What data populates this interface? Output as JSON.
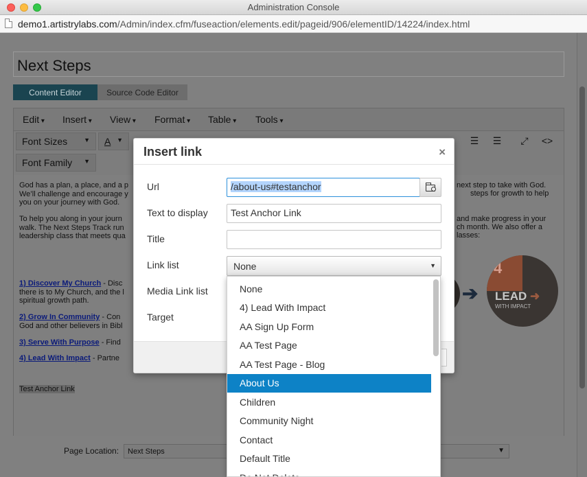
{
  "window": {
    "title": "Administration Console",
    "url_host": "demo1.artistrylabs.com",
    "url_path": "/Admin/index.cfm/fuseaction/elements.edit/pageid/906/elementID/14224/index.html"
  },
  "page": {
    "title_value": "Next Steps",
    "tabs": [
      "Content Editor",
      "Source Code Editor"
    ]
  },
  "editor": {
    "menu": [
      "Edit",
      "Insert",
      "View",
      "Format",
      "Table",
      "Tools"
    ],
    "font_sizes_label": "Font Sizes",
    "font_family_label": "Font Family",
    "text_color_glyph": "A"
  },
  "doc": {
    "p1_left": "God has a plan, a place, and a p",
    "p1_left_2": "We’ll challenge and encourage y",
    "p1_left_3": "you on your journey with God.",
    "p1_right": "next step to take with God.",
    "p1_right_2": "steps for growth to help",
    "p2_left": "To help you along in your journ",
    "p2_left_2": "walk. The Next Steps Track run",
    "p2_left_3": "leadership class that meets qua",
    "p2_right": "and make progress in your",
    "p2_right_2": "ch month. We also offer a",
    "p2_right_3": "lasses:",
    "step1_link": "1) Discover My Church",
    "step1_text": " - Disc",
    "step1_line2": "there is to My Church, and the l",
    "step1_line3": "spiritual growth path.",
    "step2_link": "2) Grow In Community",
    "step2_text": " - Con",
    "step2_line2": "God and other believers in Bibl",
    "step3_link": "3) Serve With Purpose",
    "step3_text": " - Find",
    "step4_link": "4) Lead With Impact",
    "step4_text": " - Partne",
    "anchor_text": "Test Anchor Link",
    "badge_num": "4",
    "badge_word": "LEAD",
    "badge_sub": "WITH IMPACT"
  },
  "location": {
    "label": "Page Location:",
    "value": "Next Steps"
  },
  "modal": {
    "title": "Insert link",
    "close_glyph": "×",
    "labels": {
      "url": "Url",
      "text": "Text to display",
      "title": "Title",
      "link_list": "Link list",
      "media_link_list": "Media Link list",
      "target": "Target"
    },
    "url_value": "/about-us#testanchor",
    "text_value": "Test Anchor Link",
    "title_value": "",
    "link_list_value": "None"
  },
  "dropdown": {
    "items": [
      "None",
      "4) Lead With Impact",
      "AA Sign Up Form",
      "AA Test Page",
      "AA Test Page - Blog",
      "About Us",
      "Children",
      "Community Night",
      "Contact",
      "Default Title",
      "Do Not Delete"
    ],
    "active": "About Us"
  }
}
